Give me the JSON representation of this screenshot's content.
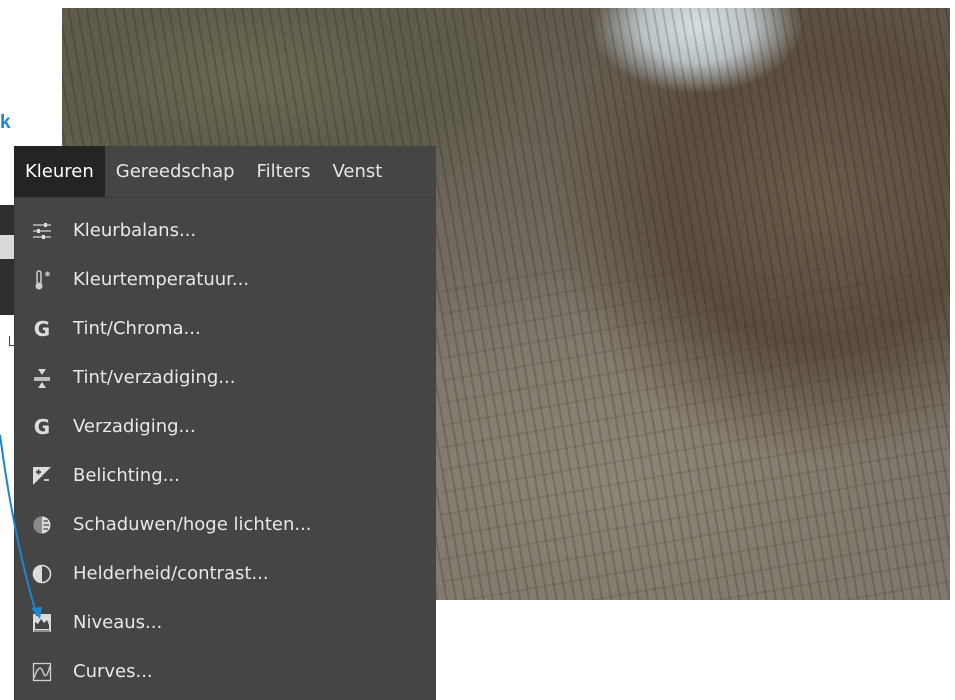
{
  "cut_off_text": "k",
  "menubar": {
    "items": [
      {
        "label": "Kleuren",
        "active": true
      },
      {
        "label": "Gereedschap",
        "active": false
      },
      {
        "label": "Filters",
        "active": false
      },
      {
        "label": "Venst",
        "active": false
      }
    ]
  },
  "menu": {
    "items": [
      {
        "label": "Kleurbalans...",
        "icon": "color-balance-icon"
      },
      {
        "label": "Kleurtemperatuur...",
        "icon": "thermometer-icon"
      },
      {
        "label": "Tint/Chroma...",
        "icon": "gegl-g-icon"
      },
      {
        "label": "Tint/verzadiging...",
        "icon": "hue-saturation-icon"
      },
      {
        "label": "Verzadiging...",
        "icon": "gegl-g-icon"
      },
      {
        "label": "Belichting...",
        "icon": "exposure-icon"
      },
      {
        "label": "Schaduwen/hoge lichten...",
        "icon": "shadows-highlights-icon"
      },
      {
        "label": "Helderheid/contrast...",
        "icon": "brightness-contrast-icon"
      },
      {
        "label": "Niveaus...",
        "icon": "levels-icon"
      },
      {
        "label": "Curves...",
        "icon": "curves-icon"
      }
    ]
  },
  "colors": {
    "menu_bg": "#454545",
    "menu_active_bg": "#242424",
    "menu_text": "#e8e8e8",
    "annotation_blue": "#1a86cf"
  }
}
